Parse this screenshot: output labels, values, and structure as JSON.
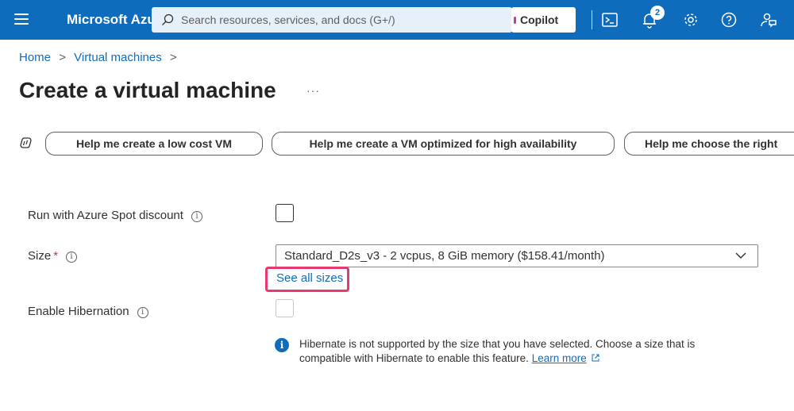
{
  "topbar": {
    "brand": "Microsoft Azure",
    "search_placeholder": "Search resources, services, and docs (G+/)",
    "copilot_label": "Copilot",
    "notification_count": "2",
    "colors": {
      "bar": "#0f6cbd"
    }
  },
  "breadcrumb": {
    "items": [
      "Home",
      "Virtual machines"
    ],
    "separator": ">"
  },
  "page": {
    "title": "Create a virtual machine",
    "more_label": "···"
  },
  "prompts": [
    "Help me create a low cost VM",
    "Help me create a VM optimized for high availability",
    "Help me choose the right"
  ],
  "form": {
    "spot": {
      "label": "Run with Azure Spot discount",
      "checked": false
    },
    "size": {
      "label": "Size",
      "required_mark": "*",
      "value": "Standard_D2s_v3 - 2 vcpus, 8 GiB memory ($158.41/month)",
      "see_all_link": "See all sizes"
    },
    "hibernation": {
      "label": "Enable Hibernation",
      "checked": false,
      "disabled": true,
      "info_text": "Hibernate is not supported by the size that you have selected. Choose a size that is compatible with Hibernate to enable this feature.",
      "learn_more": "Learn more"
    }
  },
  "icons": {
    "info": "i"
  }
}
